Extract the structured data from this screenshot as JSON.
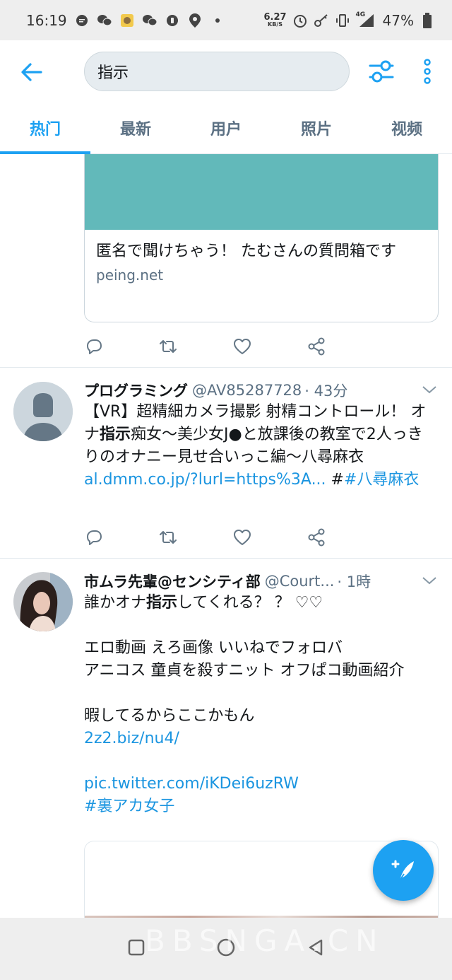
{
  "status_bar": {
    "time": "16:19",
    "net_speed": "6.27",
    "net_unit": "KB/S",
    "network_type": "4G",
    "battery": "47%"
  },
  "search": {
    "query": "指示"
  },
  "tabs": [
    {
      "label": "热门",
      "active": true
    },
    {
      "label": "最新",
      "active": false
    },
    {
      "label": "用户",
      "active": false
    },
    {
      "label": "照片",
      "active": false
    },
    {
      "label": "视频",
      "active": false
    }
  ],
  "card": {
    "title": "匿名で聞けちゃう！ たむさんの質問箱です",
    "domain": "peing.net"
  },
  "tweets": [
    {
      "name": "プログラミング",
      "handle": "@AV85287728",
      "time": "· 43分",
      "text_before": "【VR】超精細カメラ撮影 射精コントロール！ オナ",
      "text_highlight": "指示",
      "text_after": "痴女～美少女J●と放課後の教室で2人っきりのオナニー見せ合いっこ編～八尋麻衣",
      "link": "al.dmm.co.jp/?lurl=https%3A...",
      "hashtag_prefix": " #",
      "hashtag": "#八尋麻衣"
    },
    {
      "name": "市ムラ先輩@センシティ部",
      "handle": "@Court...",
      "time": "· 1時",
      "line1_before": "誰かオナ",
      "line1_highlight": "指示",
      "line1_after": "してくれる？ ？ ♡♡",
      "line2": "エロ動画 えろ画像 いいねでフォロバ",
      "line3": "アニコス 童貞を殺すニット オフぱコ動画紹介",
      "line4": "暇してるからここかもん",
      "link1": "2z2.biz/nu4/",
      "link2": "pic.twitter.com/iKDei6uzRW",
      "hashtag": "#裏アカ女子"
    }
  ],
  "watermark": "BBSNGA.CN",
  "colors": {
    "accent": "#1da1f2",
    "link": "#1b95e0",
    "card_image": "#62b9ba"
  }
}
